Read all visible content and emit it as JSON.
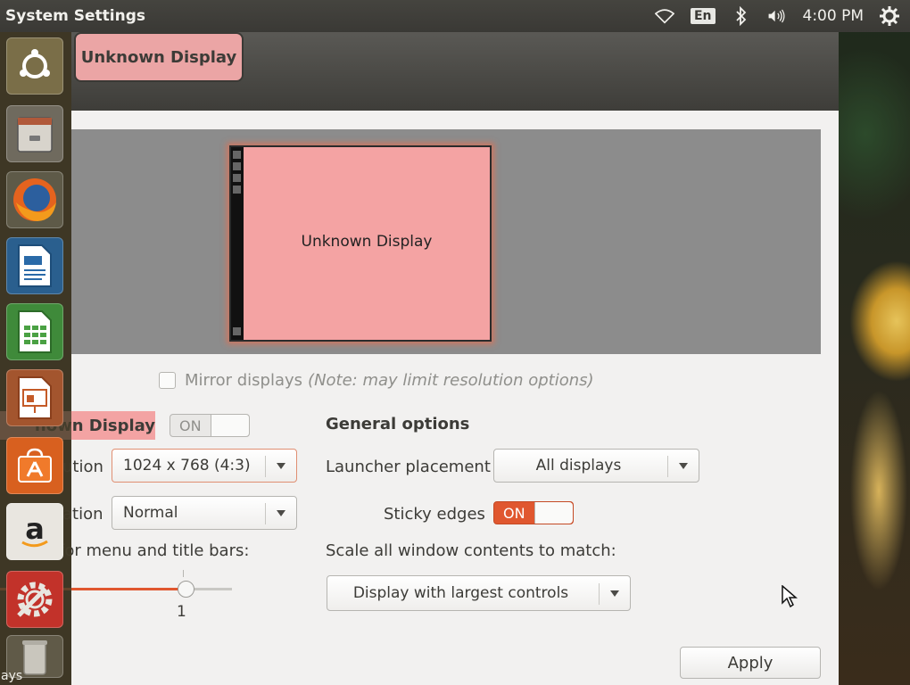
{
  "top_panel": {
    "app_title": "System Settings",
    "keyboard_layout": "En",
    "clock": "4:00 PM",
    "icons": [
      "wifi-icon",
      "bluetooth-icon",
      "volume-icon",
      "session-gear-icon"
    ]
  },
  "header": {
    "display_tab": "Unknown Display"
  },
  "preview": {
    "monitor_label": "Unknown Display"
  },
  "mirror": {
    "label": "Mirror displays",
    "note": "(Note: may limit resolution options)"
  },
  "display": {
    "name": "nown Display",
    "toggle": "ON",
    "resolution_label": "ution",
    "resolution_value": "1024 x 768 (4:3)",
    "rotation_label": "ation",
    "rotation_value": "Normal",
    "scale_label": "for menu and title bars:",
    "scale_value": "1",
    "scale_fraction": 0.8
  },
  "general": {
    "title": "General options",
    "launcher_label": "Launcher placement",
    "launcher_value": "All displays",
    "sticky_label": "Sticky edges",
    "sticky_toggle": "ON",
    "scale_all_label": "Scale all window contents to match:",
    "scale_all_value": "Display with largest controls"
  },
  "apply": "Apply",
  "launcher": {
    "items": [
      "ubuntu-dash-icon",
      "files-icon",
      "firefox-icon",
      "writer-icon",
      "calc-icon",
      "impress-icon",
      "software-center-icon",
      "amazon-icon",
      "system-settings-icon",
      "trash-icon"
    ],
    "trash_caption": "ays"
  },
  "colors": {
    "accent": "#e0572f",
    "selection": "#f3a3a3",
    "panel": "#3a3935"
  }
}
